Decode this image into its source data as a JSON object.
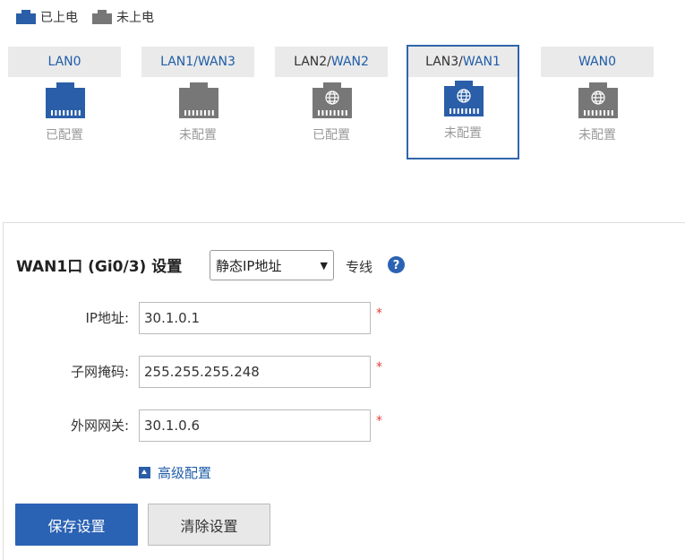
{
  "legend": {
    "powered_label": "已上电",
    "unpowered_label": "未上电"
  },
  "colors": {
    "powered": "#2a5ea8",
    "unpowered": "#777777",
    "accent": "#2a62b4",
    "required": "#e0413a"
  },
  "ports": [
    {
      "primary": "LAN0",
      "secondary": "",
      "status": "已配置",
      "powered": true,
      "globe": false,
      "selected": false
    },
    {
      "primary": "LAN1/",
      "secondary": "WAN3",
      "status": "未配置",
      "powered": false,
      "globe": false,
      "selected": false
    },
    {
      "primary": "LAN2/",
      "secondary": "WAN2",
      "status": "已配置",
      "powered": false,
      "globe": true,
      "selected": false
    },
    {
      "primary": "LAN3/",
      "secondary": "WAN1",
      "status": "未配置",
      "powered": true,
      "globe": true,
      "selected": true
    },
    {
      "primary": "WAN0",
      "secondary": "",
      "status": "未配置",
      "powered": false,
      "globe": true,
      "selected": false
    }
  ],
  "form": {
    "title": "WAN1口 (Gi0/3) 设置",
    "mode_value": "静态IP地址",
    "line_type": "专线",
    "help_icon": "question-circle-icon"
  },
  "fields": {
    "ip": {
      "label": "IP地址:",
      "value": "30.1.0.1",
      "required": "*"
    },
    "mask": {
      "label": "子网掩码:",
      "value": "255.255.255.248",
      "required": "*"
    },
    "gateway": {
      "label": "外网网关:",
      "value": "30.1.0.6",
      "required": "*"
    }
  },
  "advanced": {
    "label": "高级配置",
    "icon": "triangle-up-icon"
  },
  "buttons": {
    "save": "保存设置",
    "clear": "清除设置"
  }
}
